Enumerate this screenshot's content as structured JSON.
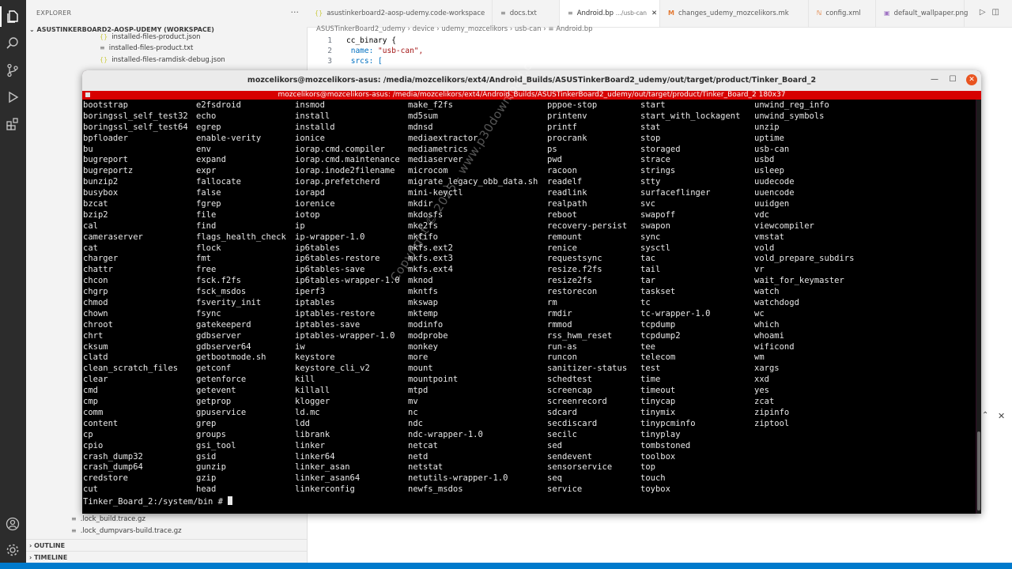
{
  "explorer": {
    "title": "EXPLORER",
    "more": "···",
    "workspace": "ASUSTINKERBOARD2-AOSP-UDEMY (WORKSPACE)",
    "files_top": [
      {
        "icon": "{}",
        "name": "installed-files-product.json"
      },
      {
        "icon": "≡",
        "name": "installed-files-product.txt"
      },
      {
        "icon": "{}",
        "name": "installed-files-ramdisk-debug.json"
      }
    ],
    "files_bottom": [
      {
        "icon": "≡",
        "name": ".lock_build.trace.gz"
      },
      {
        "icon": "≡",
        "name": ".lock_dumpvars-build.trace.gz"
      }
    ],
    "outline": "OUTLINE",
    "timeline": "TIMELINE"
  },
  "tabs": [
    {
      "icon": "{}",
      "label": "asustinkerboard2-aosp-udemy.code-workspace",
      "color": "#cbcb41"
    },
    {
      "icon": "≡",
      "label": "docs.txt",
      "color": "#6b6b6b"
    },
    {
      "icon": "≡",
      "label": "Android.bp",
      "suffix": ".../usb-can",
      "color": "#6b6b6b",
      "active": true
    },
    {
      "icon": "M",
      "label": "changes_udemy_mozcelikors.mk",
      "color": "#e37933"
    },
    {
      "icon": "ℕ",
      "label": "config.xml",
      "color": "#e37933"
    },
    {
      "icon": "▣",
      "label": "default_wallpaper.png",
      "color": "#a074c4"
    }
  ],
  "breadcrumb": "ASUSTinkerBoard2_udemy  ›  device  ›  udemy_mozcelikors  ›  usb-can  ›  ≡  Android.bp",
  "code": [
    {
      "n": "1",
      "a": "cc_binary {",
      "b": ""
    },
    {
      "n": "2",
      "a": "    name: ",
      "b": "\"usb-can\","
    },
    {
      "n": "3",
      "a": "    srcs: [",
      "b": ""
    }
  ],
  "terminal": {
    "window_title": "mozcelikors@mozcelikors-asus: /media/mozcelikors/ext4/Android_Builds/ASUSTinkerBoard2_udemy/out/target/product/Tinker_Board_2",
    "inner_title": "mozcelikors@mozcelikors-asus: /media/mozcelikors/ext4/Android_Builds/ASUSTinkerBoard2_udemy/out/target/product/Tinker_Board_2 180x37",
    "columns": [
      [
        "bootstrap",
        "boringssl_self_test32",
        "boringssl_self_test64",
        "bpfloader",
        "bu",
        "bugreport",
        "bugreportz",
        "bunzip2",
        "busybox",
        "bzcat",
        "bzip2",
        "cal",
        "cameraserver",
        "cat",
        "charger",
        "chattr",
        "chcon",
        "chgrp",
        "chmod",
        "chown",
        "chroot",
        "chrt",
        "cksum",
        "clatd",
        "clean_scratch_files",
        "clear",
        "cmd",
        "cmp",
        "comm",
        "content",
        "cp",
        "cpio",
        "crash_dump32",
        "crash_dump64",
        "credstore",
        "cut"
      ],
      [
        "e2fsdroid",
        "echo",
        "egrep",
        "enable-verity",
        "env",
        "expand",
        "expr",
        "fallocate",
        "false",
        "fgrep",
        "file",
        "find",
        "flags_health_check",
        "flock",
        "fmt",
        "free",
        "fsck.f2fs",
        "fsck_msdos",
        "fsverity_init",
        "fsync",
        "gatekeeperd",
        "gdbserver",
        "gdbserver64",
        "getbootmode.sh",
        "getconf",
        "getenforce",
        "getevent",
        "getprop",
        "gpuservice",
        "grep",
        "groups",
        "gsi_tool",
        "gsid",
        "gunzip",
        "gzip",
        "head"
      ],
      [
        "insmod",
        "install",
        "installd",
        "ionice",
        "iorap.cmd.compiler",
        "iorap.cmd.maintenance",
        "iorap.inode2filename",
        "iorap.prefetcherd",
        "iorapd",
        "iorenice",
        "iotop",
        "ip",
        "ip-wrapper-1.0",
        "ip6tables",
        "ip6tables-restore",
        "ip6tables-save",
        "ip6tables-wrapper-1.0",
        "iperf3",
        "iptables",
        "iptables-restore",
        "iptables-save",
        "iptables-wrapper-1.0",
        "iw",
        "keystore",
        "keystore_cli_v2",
        "kill",
        "killall",
        "klogger",
        "ld.mc",
        "ldd",
        "librank",
        "linker",
        "linker64",
        "linker_asan",
        "linker_asan64",
        "linkerconfig"
      ],
      [
        "make_f2fs",
        "md5sum",
        "mdnsd",
        "mediaextractor",
        "mediametrics",
        "mediaserver",
        "microcom",
        "migrate_legacy_obb_data.sh",
        "mini-keyctl",
        "mkdir",
        "mkdosfs",
        "mke2fs",
        "mkfifo",
        "mkfs.ext2",
        "mkfs.ext3",
        "mkfs.ext4",
        "mknod",
        "mkntfs",
        "mkswap",
        "mktemp",
        "modinfo",
        "modprobe",
        "monkey",
        "more",
        "mount",
        "mountpoint",
        "mtpd",
        "mv",
        "nc",
        "ndc",
        "ndc-wrapper-1.0",
        "netcat",
        "netd",
        "netstat",
        "netutils-wrapper-1.0",
        "newfs_msdos"
      ],
      [
        "pppoe-stop",
        "printenv",
        "printf",
        "procrank",
        "ps",
        "pwd",
        "racoon",
        "readelf",
        "readlink",
        "realpath",
        "reboot",
        "recovery-persist",
        "remount",
        "renice",
        "requestsync",
        "resize.f2fs",
        "resize2fs",
        "restorecon",
        "rm",
        "rmdir",
        "rmmod",
        "rss_hwm_reset",
        "run-as",
        "runcon",
        "sanitizer-status",
        "schedtest",
        "screencap",
        "screenrecord",
        "sdcard",
        "secdiscard",
        "secilc",
        "sed",
        "sendevent",
        "sensorservice",
        "seq",
        "service"
      ],
      [
        "start",
        "start_with_lockagent",
        "stat",
        "stop",
        "storaged",
        "strace",
        "strings",
        "stty",
        "surfaceflinger",
        "svc",
        "swapoff",
        "swapon",
        "sync",
        "sysctl",
        "tac",
        "tail",
        "tar",
        "taskset",
        "tc",
        "tc-wrapper-1.0",
        "tcpdump",
        "tcpdump2",
        "tee",
        "telecom",
        "test",
        "time",
        "timeout",
        "tinycap",
        "tinymix",
        "tinypcminfo",
        "tinyplay",
        "tombstoned",
        "toolbox",
        "top",
        "touch",
        "toybox"
      ],
      [
        "unwind_reg_info",
        "unwind_symbols",
        "unzip",
        "uptime",
        "usb-can",
        "usbd",
        "usleep",
        "uudecode",
        "uuencode",
        "uuidgen",
        "vdc",
        "viewcompiler",
        "vmstat",
        "vold",
        "vold_prepare_subdirs",
        "vr",
        "wait_for_keymaster",
        "watch",
        "watchdogd",
        "wc",
        "which",
        "whoami",
        "wificond",
        "wm",
        "xargs",
        "xxd",
        "yes",
        "zcat",
        "zipinfo",
        "ziptool"
      ]
    ],
    "prompt": "Tinker_Board_2:/system/bin # "
  },
  "watermark": "Copyright © 2025 - www.p30download.com",
  "udemy": "ûdemy"
}
